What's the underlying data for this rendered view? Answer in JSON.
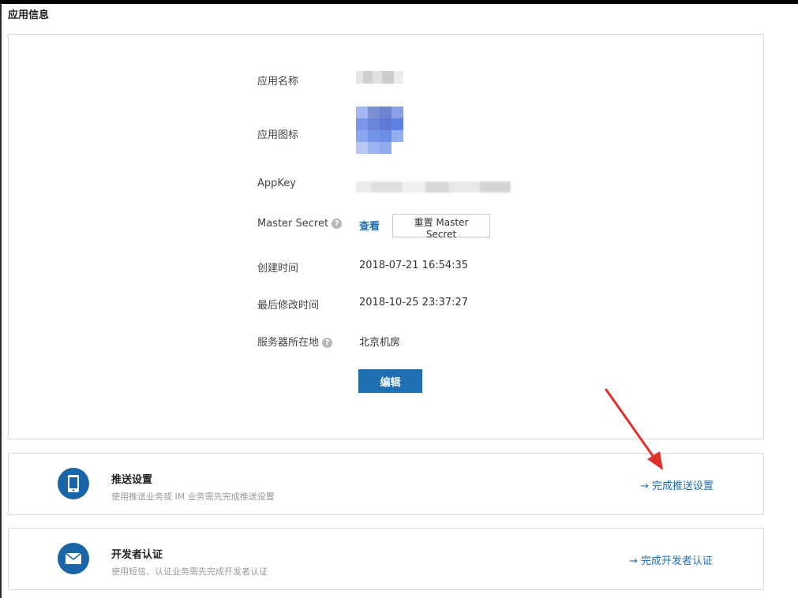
{
  "section_title": "应用信息",
  "app_info": {
    "name_label": "应用名称",
    "icon_label": "应用图标",
    "appkey_label": "AppKey",
    "master_secret_label": "Master Secret",
    "view_label": "查看",
    "reset_label": "重置 Master Secret",
    "created_label": "创建时间",
    "created_value": "2018-07-21 16:54:35",
    "modified_label": "最后修改时间",
    "modified_value": "2018-10-25 23:37:27",
    "server_label": "服务器所在地",
    "server_value": "北京机房",
    "help_symbol": "?",
    "edit_label": "编辑"
  },
  "tasks": [
    {
      "title": "推送设置",
      "desc": "使用推送业务或 IM 业务需先完成推送设置",
      "link": "完成推送设置",
      "icon": "phone-icon"
    },
    {
      "title": "开发者认证",
      "desc": "使用短信、认证业务需先完成开发者认证",
      "link": "完成开发者认证",
      "icon": "envelope-icon"
    }
  ],
  "arrow_symbol": "→",
  "colors": {
    "accent": "#1f6fb2",
    "icon_bg": "#1a64a8",
    "annotation": "#e0302b"
  }
}
